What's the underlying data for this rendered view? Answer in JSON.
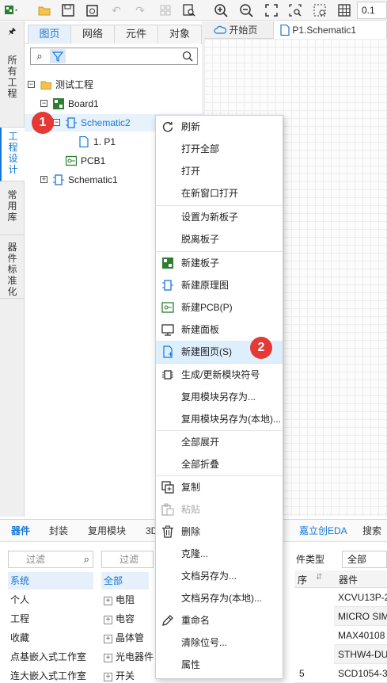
{
  "toolbar": {
    "zoom_value": "0.1",
    "icons": [
      "app-menu-icon",
      "folder-icon",
      "save-icon",
      "save-all-icon",
      "undo-icon",
      "redo-icon",
      "grid-select-icon",
      "find-icon",
      "zoom-in-icon",
      "zoom-out-icon",
      "fit-icon",
      "zoom-area-icon",
      "grid-icon"
    ]
  },
  "vertical_tabs": [
    {
      "label": "所有工程",
      "active": false
    },
    {
      "label": "工程设计",
      "active": true
    },
    {
      "label": "常用库",
      "active": false
    },
    {
      "label": "器件标准化",
      "active": false
    }
  ],
  "left_panel": {
    "tabs": [
      "图页",
      "网络",
      "元件",
      "对象"
    ],
    "active_tab": "图页"
  },
  "tree": [
    {
      "label": "测试工程",
      "level": 0,
      "expand": "−",
      "icon": "folder-icon"
    },
    {
      "label": "Board1",
      "level": 1,
      "expand": "−",
      "icon": "board-icon"
    },
    {
      "label": "Schematic2",
      "level": 2,
      "expand": "−",
      "icon": "schematic-icon",
      "selected": true
    },
    {
      "label": "1. P1",
      "level": 3,
      "expand": "",
      "icon": "page-icon"
    },
    {
      "label": "PCB1",
      "level": 2,
      "expand": "",
      "icon": "pcb-icon"
    },
    {
      "label": "Schematic1",
      "level": 1,
      "expand": "+",
      "icon": "schematic-icon"
    }
  ],
  "editor_tabs": [
    {
      "label": "开始页",
      "icon": "cloud-icon"
    },
    {
      "label": "P1.Schematic1",
      "icon": "page-icon"
    }
  ],
  "badges": [
    "1",
    "2"
  ],
  "context_menu": {
    "items": [
      {
        "label": "刷新",
        "icon": "refresh-icon",
        "group": 0
      },
      {
        "label": "打开全部",
        "icon": "",
        "group": 0
      },
      {
        "label": "打开",
        "icon": "",
        "group": 0
      },
      {
        "label": "在新窗口打开",
        "icon": "",
        "group": 0
      },
      {
        "label": "设置为新板子",
        "icon": "",
        "group": 1
      },
      {
        "label": "脱离板子",
        "icon": "",
        "group": 1
      },
      {
        "label": "新建板子",
        "icon": "board-icon",
        "group": 2
      },
      {
        "label": "新建原理图",
        "icon": "schematic-icon",
        "group": 2
      },
      {
        "label": "新建PCB(P)",
        "icon": "pcb-icon",
        "group": 2
      },
      {
        "label": "新建面板",
        "icon": "panel-icon",
        "group": 2
      },
      {
        "label": "新建图页(S)",
        "icon": "page-icon",
        "group": 2,
        "highlighted": true
      },
      {
        "label": "生成/更新模块符号",
        "icon": "chip-icon",
        "group": 3
      },
      {
        "label": "复用模块另存为...",
        "icon": "",
        "group": 3
      },
      {
        "label": "复用模块另存为(本地)...",
        "icon": "",
        "group": 3
      },
      {
        "label": "全部展开",
        "icon": "",
        "group": 4
      },
      {
        "label": "全部折叠",
        "icon": "",
        "group": 4
      },
      {
        "label": "复制",
        "icon": "copy-icon",
        "group": 5
      },
      {
        "label": "粘贴",
        "icon": "paste-icon",
        "group": 5,
        "disabled": true
      },
      {
        "label": "删除",
        "icon": "delete-icon",
        "group": 5
      },
      {
        "label": "克隆...",
        "icon": "",
        "group": 5
      },
      {
        "label": "文档另存为...",
        "icon": "",
        "group": 5
      },
      {
        "label": "文档另存为(本地)...",
        "icon": "",
        "group": 5
      },
      {
        "label": "重命名",
        "icon": "rename-icon",
        "group": 5
      },
      {
        "label": "清除位号...",
        "icon": "",
        "group": 5
      },
      {
        "label": "属性",
        "icon": "",
        "group": 5
      }
    ]
  },
  "bottom": {
    "tabs": [
      "器件",
      "封装",
      "复用模块",
      "3D"
    ],
    "active_tab": "器件",
    "right_tabs": [
      "嘉立创EDA",
      "搜索"
    ],
    "filter_placeholder_1": "过滤",
    "filter_placeholder_2": "过滤",
    "library_list": [
      "系统",
      "个人",
      "工程",
      "收藏",
      "点基嵌入式工作室",
      "连大嵌入式工作室"
    ],
    "selected_library": "系统",
    "categories": [
      "全部",
      "电阻",
      "电容",
      "晶体管",
      "光电器件",
      "开关"
    ],
    "selected_category": "全部",
    "type_label": "件类型",
    "type_value": "全部",
    "table_header": {
      "num": "序",
      "device": "器件"
    },
    "rows": [
      {
        "num": "",
        "device": "XCVU13P-2"
      },
      {
        "num": "",
        "device": "MICRO SIM"
      },
      {
        "num": "",
        "device": "MAX40108"
      },
      {
        "num": "",
        "device": "STHW4-DU"
      },
      {
        "num": "5",
        "device": "SCD1054-3"
      }
    ]
  }
}
